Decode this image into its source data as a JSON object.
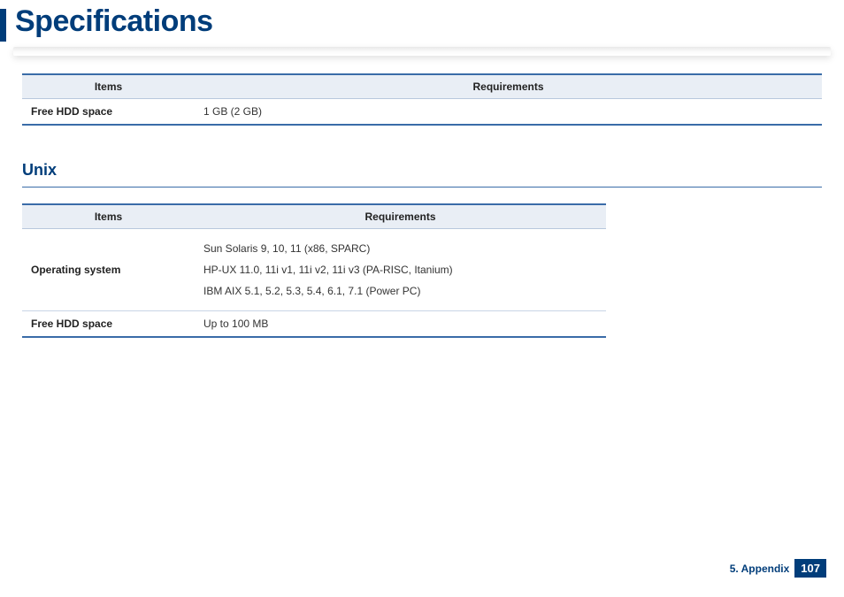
{
  "page": {
    "title": "Specifications"
  },
  "table1": {
    "headers": {
      "items": "Items",
      "requirements": "Requirements"
    },
    "rows": [
      {
        "item": "Free HDD space",
        "req": "1 GB (2 GB)"
      }
    ]
  },
  "section": {
    "heading": "Unix"
  },
  "table2": {
    "headers": {
      "items": "Items",
      "requirements": "Requirements"
    },
    "rows": [
      {
        "item": "Operating system",
        "req_line1": "Sun Solaris 9, 10, 11 (x86, SPARC)",
        "req_line2": "HP-UX 11.0, 11i v1, 11i v2, 11i v3 (PA-RISC, Itanium)",
        "req_line3": "IBM AIX 5.1, 5.2, 5.3, 5.4, 6.1, 7.1 (Power PC)"
      },
      {
        "item": "Free HDD space",
        "req": "Up to 100 MB"
      }
    ]
  },
  "footer": {
    "section_label": "5. Appendix",
    "page_number": "107"
  }
}
